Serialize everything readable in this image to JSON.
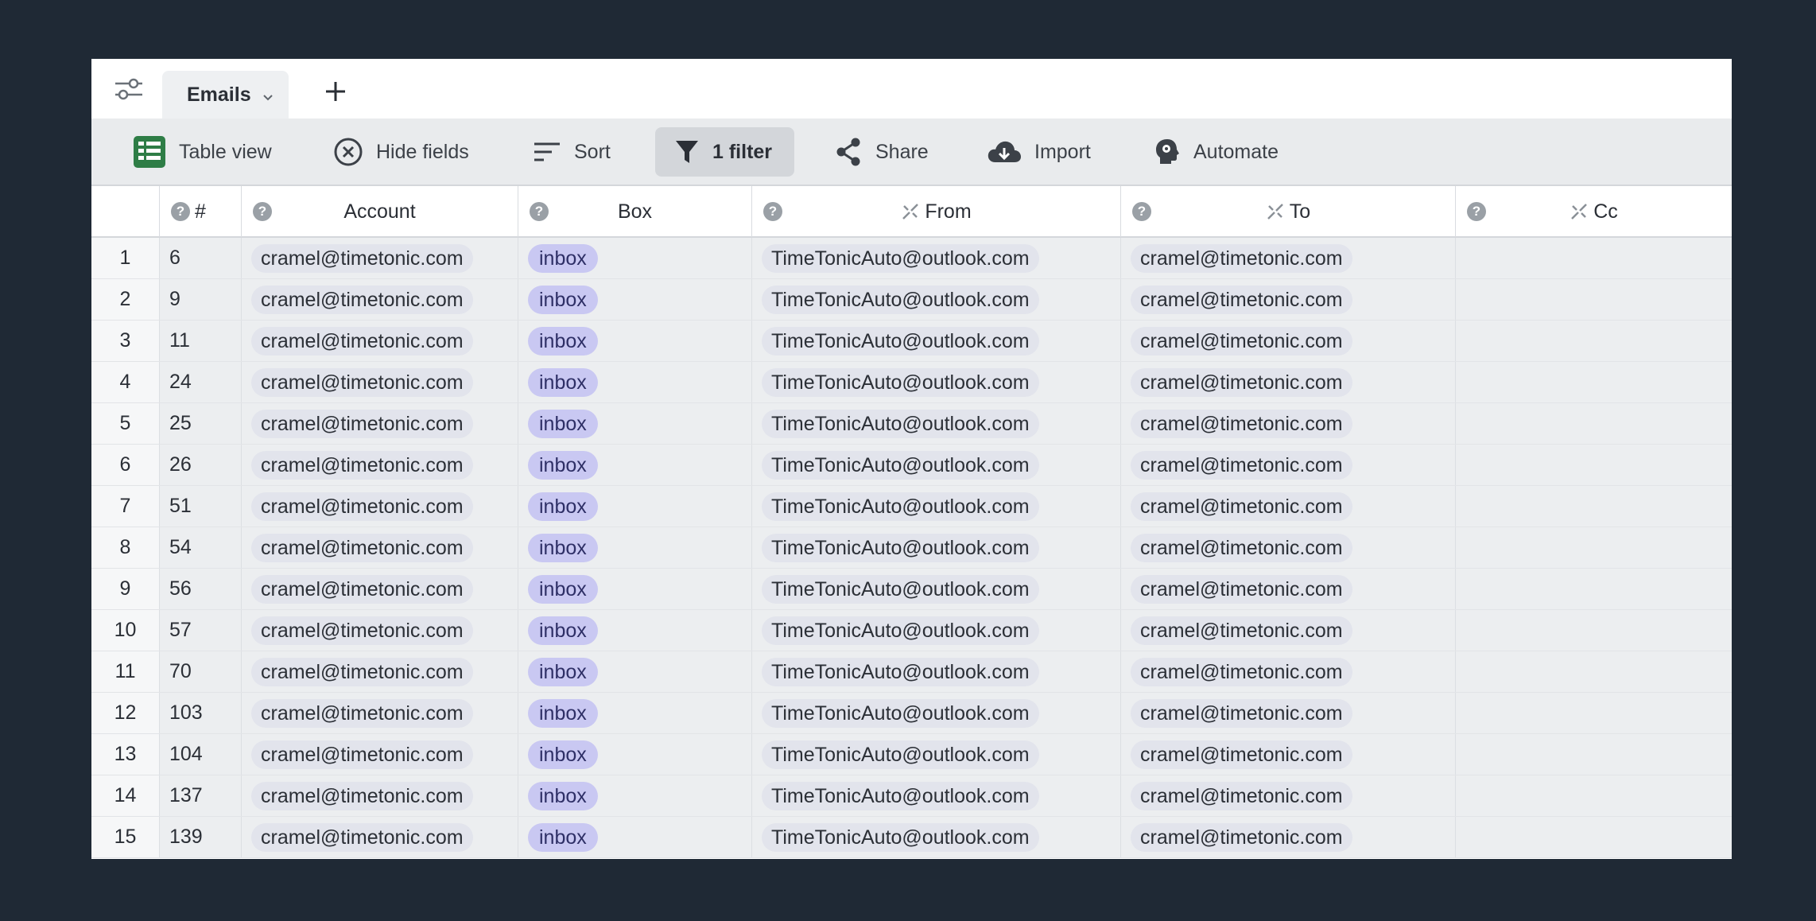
{
  "tabs": {
    "active_tab": "Emails"
  },
  "toolbar": {
    "table_view": "Table view",
    "hide_fields": "Hide fields",
    "sort": "Sort",
    "filter": "1 filter",
    "share": "Share",
    "import": "Import",
    "automate": "Automate"
  },
  "columns": {
    "num": "#",
    "account": "Account",
    "box": "Box",
    "from": "From",
    "to": "To",
    "cc": "Cc",
    "help_glyph": "?"
  },
  "rows": [
    {
      "idx": "1",
      "num": "6",
      "account": "cramel@timetonic.com",
      "box": "inbox",
      "from": "TimeTonicAuto@outlook.com",
      "to": "cramel@timetonic.com"
    },
    {
      "idx": "2",
      "num": "9",
      "account": "cramel@timetonic.com",
      "box": "inbox",
      "from": "TimeTonicAuto@outlook.com",
      "to": "cramel@timetonic.com"
    },
    {
      "idx": "3",
      "num": "11",
      "account": "cramel@timetonic.com",
      "box": "inbox",
      "from": "TimeTonicAuto@outlook.com",
      "to": "cramel@timetonic.com"
    },
    {
      "idx": "4",
      "num": "24",
      "account": "cramel@timetonic.com",
      "box": "inbox",
      "from": "TimeTonicAuto@outlook.com",
      "to": "cramel@timetonic.com"
    },
    {
      "idx": "5",
      "num": "25",
      "account": "cramel@timetonic.com",
      "box": "inbox",
      "from": "TimeTonicAuto@outlook.com",
      "to": "cramel@timetonic.com"
    },
    {
      "idx": "6",
      "num": "26",
      "account": "cramel@timetonic.com",
      "box": "inbox",
      "from": "TimeTonicAuto@outlook.com",
      "to": "cramel@timetonic.com"
    },
    {
      "idx": "7",
      "num": "51",
      "account": "cramel@timetonic.com",
      "box": "inbox",
      "from": "TimeTonicAuto@outlook.com",
      "to": "cramel@timetonic.com"
    },
    {
      "idx": "8",
      "num": "54",
      "account": "cramel@timetonic.com",
      "box": "inbox",
      "from": "TimeTonicAuto@outlook.com",
      "to": "cramel@timetonic.com"
    },
    {
      "idx": "9",
      "num": "56",
      "account": "cramel@timetonic.com",
      "box": "inbox",
      "from": "TimeTonicAuto@outlook.com",
      "to": "cramel@timetonic.com"
    },
    {
      "idx": "10",
      "num": "57",
      "account": "cramel@timetonic.com",
      "box": "inbox",
      "from": "TimeTonicAuto@outlook.com",
      "to": "cramel@timetonic.com"
    },
    {
      "idx": "11",
      "num": "70",
      "account": "cramel@timetonic.com",
      "box": "inbox",
      "from": "TimeTonicAuto@outlook.com",
      "to": "cramel@timetonic.com"
    },
    {
      "idx": "12",
      "num": "103",
      "account": "cramel@timetonic.com",
      "box": "inbox",
      "from": "TimeTonicAuto@outlook.com",
      "to": "cramel@timetonic.com"
    },
    {
      "idx": "13",
      "num": "104",
      "account": "cramel@timetonic.com",
      "box": "inbox",
      "from": "TimeTonicAuto@outlook.com",
      "to": "cramel@timetonic.com"
    },
    {
      "idx": "14",
      "num": "137",
      "account": "cramel@timetonic.com",
      "box": "inbox",
      "from": "TimeTonicAuto@outlook.com",
      "to": "cramel@timetonic.com"
    },
    {
      "idx": "15",
      "num": "139",
      "account": "cramel@timetonic.com",
      "box": "inbox",
      "from": "TimeTonicAuto@outlook.com",
      "to": "cramel@timetonic.com"
    }
  ],
  "icons": {
    "settings": "sliders-icon",
    "tab_caret": "chevron-down-icon",
    "add_tab": "plus-icon",
    "table_view": "spreadsheet-icon",
    "hide_fields": "circle-x-icon",
    "sort": "sort-lines-icon",
    "filter": "funnel-icon",
    "share": "share-icon",
    "import": "cloud-download-icon",
    "automate": "robot-head-icon",
    "linked_field": "link-broken-icon",
    "help": "question-icon"
  },
  "colors": {
    "background": "#1f2935",
    "toolbar": "#e9ebed",
    "active_filter": "#d3d6da",
    "box_chip": "#c9c8f2",
    "table_view_icon": "#2e7d46"
  }
}
